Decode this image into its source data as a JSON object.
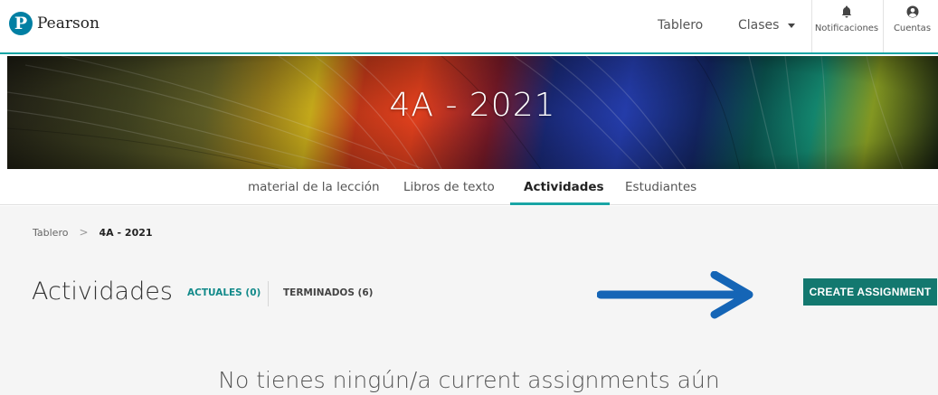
{
  "header": {
    "logo_text": "Pearson",
    "logo_mark": "P",
    "nav_dashboard": "Tablero",
    "nav_classes": "Clases",
    "notifications_label": "Notificaciones",
    "account_label": "Cuentas",
    "icons": [
      "bell-icon",
      "account-icon",
      "chevron-down-icon"
    ],
    "accent_color": "#19a5a5"
  },
  "banner": {
    "title": "4A - 2021"
  },
  "tabs": [
    {
      "label": "material de la lección",
      "active": false
    },
    {
      "label": "Libros de texto",
      "active": false
    },
    {
      "label": "Actividades",
      "active": true
    },
    {
      "label": "Estudiantes",
      "active": false
    }
  ],
  "breadcrumb": {
    "items": [
      "Tablero",
      "4A - 2021"
    ],
    "separator": ">"
  },
  "main": {
    "heading": "Actividades",
    "filter_current": "ACTUALES (0)",
    "filter_done": "TERMINADOS (6)",
    "create_button": "CREATE ASSIGNMENT",
    "empty_message": "No tienes ningún/a current assignments aún",
    "button_color": "#13786f",
    "arrow_color": "#1565b6"
  }
}
